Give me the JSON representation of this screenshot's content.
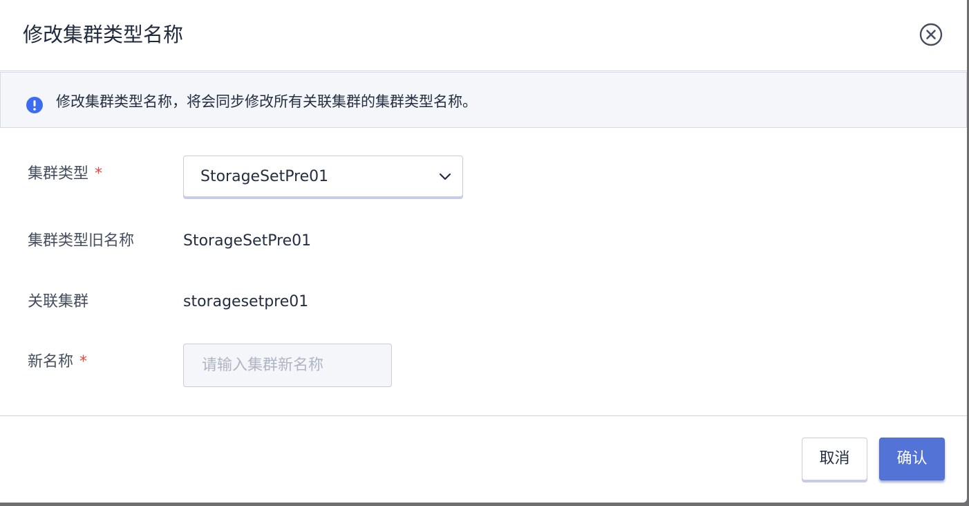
{
  "dialog": {
    "title": "修改集群类型名称"
  },
  "alert": {
    "message": "修改集群类型名称，将会同步修改所有关联集群的集群类型名称。"
  },
  "form": {
    "cluster_type": {
      "label": "集群类型",
      "required_mark": "*",
      "selected_value": "StorageSetPre01"
    },
    "old_name": {
      "label": "集群类型旧名称",
      "value": "StorageSetPre01"
    },
    "related_clusters": {
      "label": "关联集群",
      "value": "storagesetpre01"
    },
    "new_name": {
      "label": "新名称",
      "required_mark": "*",
      "value": "",
      "placeholder": "请输入集群新名称"
    }
  },
  "footer": {
    "cancel_label": "取消",
    "confirm_label": "确认"
  },
  "colors": {
    "primary": "#5373d6",
    "required": "#e5483e",
    "info_icon": "#3d6cf0"
  },
  "icons": {
    "close": "close-circle-icon",
    "alert": "info-circle-icon",
    "dropdown": "chevron-down-icon"
  }
}
